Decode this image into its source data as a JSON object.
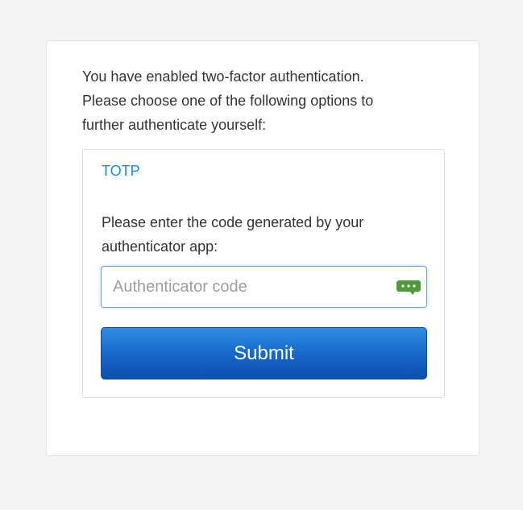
{
  "intro": {
    "line1": "You have enabled two-factor authentication.",
    "line2": "Please choose one of the following options to",
    "line3": "further authenticate yourself:"
  },
  "method": {
    "tab_label": "TOTP",
    "prompt_line1": "Please enter the code generated by your",
    "prompt_line2": "authenticator app:"
  },
  "code_input": {
    "value": "",
    "placeholder": "Authenticator code"
  },
  "submit_label": "Submit",
  "icons": {
    "password_manager": "password-manager-icon"
  },
  "colors": {
    "link": "#1d8dd2",
    "button": "#1566c8",
    "icon": "#4f9a3f"
  }
}
